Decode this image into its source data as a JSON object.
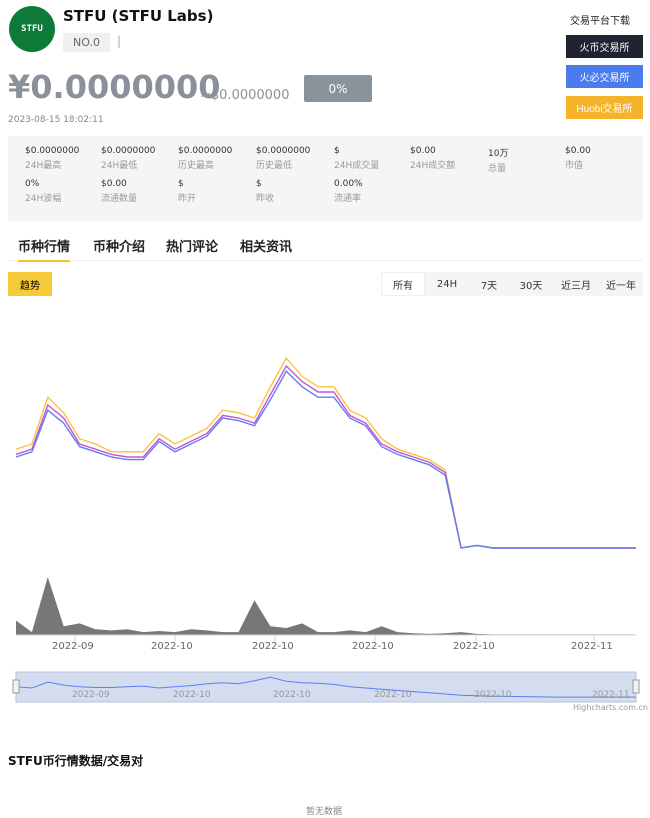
{
  "header": {
    "logo_text": "STFU",
    "title": "STFU (STFU Labs)",
    "rank": "NO.0",
    "separator": "|"
  },
  "downloads": {
    "title": "交易平台下载",
    "buttons": [
      {
        "label": "火币交易所",
        "bg": "#1f2430",
        "fg": "#ffffff"
      },
      {
        "label": "火必交易所",
        "bg": "#4a7cf0",
        "fg": "#ffffff"
      },
      {
        "label": "Huobi交易所",
        "bg": "#f4b32a",
        "fg": "#ffffff"
      }
    ]
  },
  "price": {
    "cny": "¥0.0000000",
    "usd": "≈$0.0000000",
    "change": "0%",
    "timestamp": "2023-08-15 18:02:11"
  },
  "stats": [
    {
      "value": "$0.0000000",
      "label": "24H最高"
    },
    {
      "value": "$0.0000000",
      "label": "24H最低"
    },
    {
      "value": "$0.0000000",
      "label": "历史最高"
    },
    {
      "value": "$0.0000000",
      "label": "历史最低"
    },
    {
      "value": "$",
      "label": "24H成交量"
    },
    {
      "value": "$0.00",
      "label": "24H成交额"
    },
    {
      "value": "10万",
      "label": "总量"
    },
    {
      "value": "$0.00",
      "label": "市值"
    },
    {
      "value": "0%",
      "label": "24H波幅"
    },
    {
      "value": "$0.00",
      "label": "流通数量"
    },
    {
      "value": "$",
      "label": "昨开"
    },
    {
      "value": "$",
      "label": "昨收"
    },
    {
      "value": "0.00%",
      "label": "流通率"
    }
  ],
  "tabs": [
    "币种行情",
    "币种介绍",
    "热门评论",
    "相关资讯"
  ],
  "chart_controls": {
    "trend": "趋势",
    "ranges": [
      "所有",
      "24H",
      "7天",
      "30天",
      "近三月",
      "近一年"
    ],
    "active_range": "所有"
  },
  "chart_data": {
    "type": "line",
    "x_tick_labels": [
      "2022-09",
      "2022-10",
      "2022-10",
      "2022-10",
      "2022-10",
      "2022-11"
    ],
    "navigator_tick_labels": [
      "2022-09",
      "2022-10",
      "2022-10",
      "2022-10",
      "2022-10",
      "2022-11"
    ],
    "series": [
      {
        "color": "#f5c542",
        "values": [
          0.58,
          0.6,
          0.78,
          0.72,
          0.62,
          0.6,
          0.57,
          0.57,
          0.57,
          0.64,
          0.6,
          0.63,
          0.66,
          0.73,
          0.72,
          0.7,
          0.82,
          0.93,
          0.86,
          0.82,
          0.82,
          0.73,
          0.7,
          0.62,
          0.58,
          0.56,
          0.54,
          0.5,
          0.2,
          0.21,
          0.2,
          0.2,
          0.2,
          0.2,
          0.2,
          0.2,
          0.2,
          0.2,
          0.2,
          0.2
        ]
      },
      {
        "color": "#c853d8",
        "values": [
          0.56,
          0.58,
          0.75,
          0.7,
          0.6,
          0.58,
          0.56,
          0.55,
          0.55,
          0.62,
          0.58,
          0.61,
          0.64,
          0.71,
          0.7,
          0.68,
          0.79,
          0.9,
          0.84,
          0.8,
          0.8,
          0.71,
          0.68,
          0.6,
          0.57,
          0.55,
          0.53,
          0.49,
          0.2,
          0.21,
          0.2,
          0.2,
          0.2,
          0.2,
          0.2,
          0.2,
          0.2,
          0.2,
          0.2,
          0.2
        ]
      },
      {
        "color": "#5b7ff5",
        "values": [
          0.55,
          0.57,
          0.73,
          0.68,
          0.59,
          0.57,
          0.55,
          0.54,
          0.54,
          0.61,
          0.57,
          0.6,
          0.63,
          0.7,
          0.69,
          0.67,
          0.77,
          0.88,
          0.82,
          0.78,
          0.78,
          0.7,
          0.67,
          0.59,
          0.56,
          0.54,
          0.52,
          0.48,
          0.2,
          0.21,
          0.2,
          0.2,
          0.2,
          0.2,
          0.2,
          0.2,
          0.2,
          0.2,
          0.2,
          0.2
        ]
      }
    ],
    "volume": [
      0.25,
      0.05,
      1.0,
      0.15,
      0.2,
      0.1,
      0.08,
      0.1,
      0.05,
      0.07,
      0.05,
      0.1,
      0.08,
      0.05,
      0.05,
      0.6,
      0.15,
      0.12,
      0.2,
      0.05,
      0.05,
      0.08,
      0.05,
      0.15,
      0.05,
      0.03,
      0.02,
      0.03,
      0.05,
      0.02,
      0.01,
      0.01,
      0.01,
      0.01,
      0.01,
      0.01,
      0.01,
      0.01,
      0.01,
      0.01
    ],
    "navigator": [
      0.55,
      0.5,
      0.75,
      0.62,
      0.55,
      0.52,
      0.52,
      0.55,
      0.58,
      0.5,
      0.55,
      0.6,
      0.68,
      0.72,
      0.68,
      0.8,
      0.95,
      0.78,
      0.72,
      0.7,
      0.65,
      0.55,
      0.5,
      0.45,
      0.4,
      0.35,
      0.3,
      0.25,
      0.2,
      0.18,
      0.16,
      0.15,
      0.14,
      0.13,
      0.12,
      0.12,
      0.12,
      0.12,
      0.12,
      0.12
    ],
    "credit": "Highcharts.com.cn"
  },
  "section": {
    "title": "STFU币行情数据/交易对",
    "empty": "暂无数据"
  }
}
